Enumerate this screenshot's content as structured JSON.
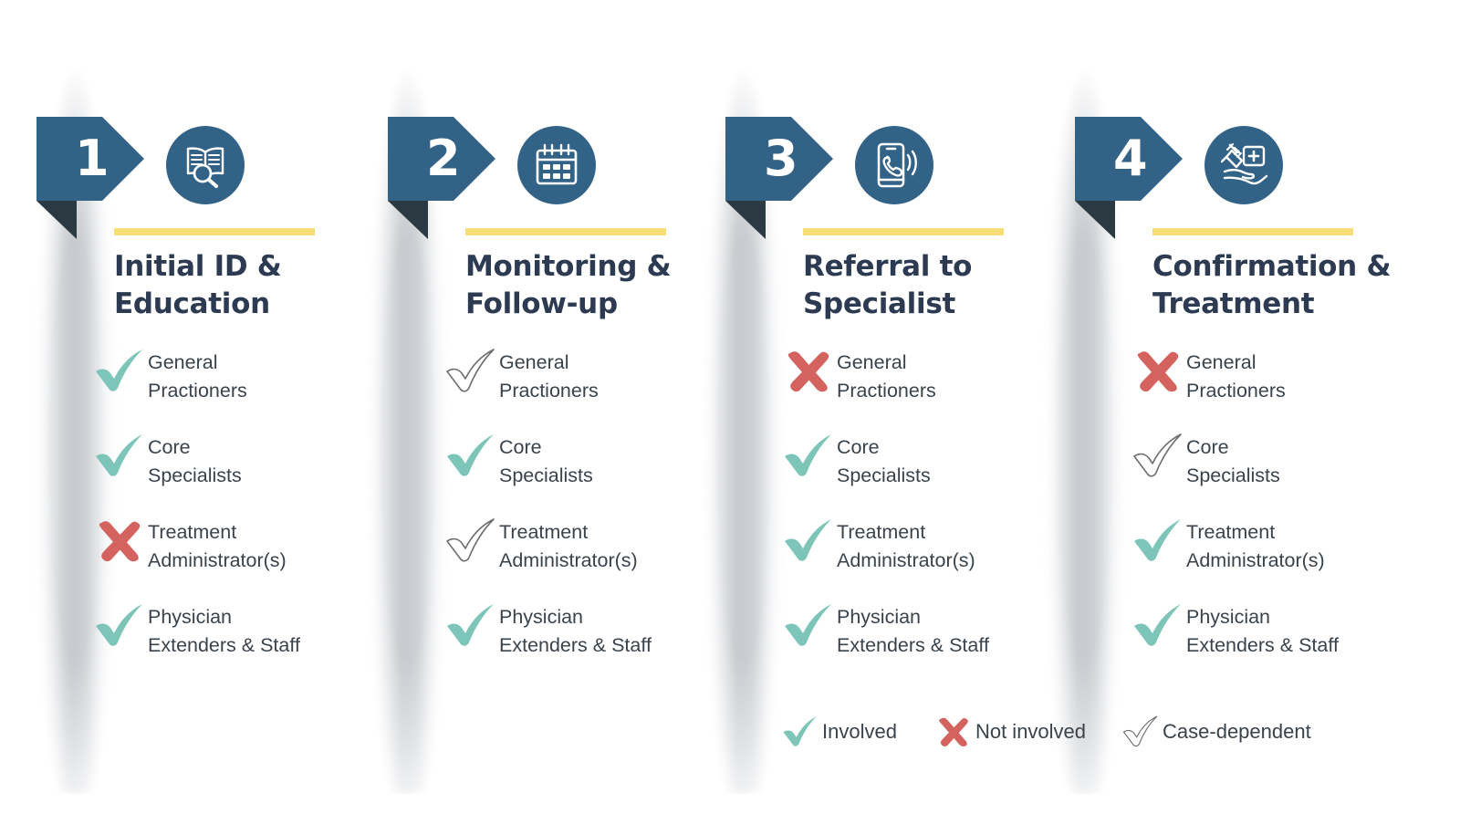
{
  "colors": {
    "brand_blue": "#336287",
    "fold_dark": "#2b3a42",
    "accent_yellow": "#F7DE77",
    "title_navy": "#2d3b52",
    "check_teal": "#7CC5B8",
    "cross_red": "#D4635F",
    "outline_gray": "#6E6E6E",
    "body_text": "#3a434c",
    "background": "#FFFFFF"
  },
  "columns": [
    {
      "number": "1",
      "icon": "book-search-icon",
      "title": "Initial ID &\nEducation",
      "items": [
        {
          "label": "General\nPractioners",
          "mark": "check"
        },
        {
          "label": "Core\nSpecialists",
          "mark": "check"
        },
        {
          "label": "Treatment\nAdministrator(s)",
          "mark": "cross"
        },
        {
          "label": "Physician\nExtenders & Staff",
          "mark": "check"
        }
      ]
    },
    {
      "number": "2",
      "icon": "calendar-icon",
      "title": "Monitoring\n& Follow-up",
      "items": [
        {
          "label": "General\nPractioners",
          "mark": "outline"
        },
        {
          "label": "Core\nSpecialists",
          "mark": "check"
        },
        {
          "label": "Treatment\nAdministrator(s)",
          "mark": "outline"
        },
        {
          "label": "Physician\nExtenders & Staff",
          "mark": "check"
        }
      ]
    },
    {
      "number": "3",
      "icon": "phone-call-icon",
      "title": "Referral to\nSpecialist",
      "items": [
        {
          "label": "General\nPractioners",
          "mark": "cross"
        },
        {
          "label": "Core\nSpecialists",
          "mark": "check"
        },
        {
          "label": "Treatment\nAdministrator(s)",
          "mark": "check"
        },
        {
          "label": "Physician\nExtenders & Staff",
          "mark": "check"
        }
      ]
    },
    {
      "number": "4",
      "icon": "syringe-hand-icon",
      "title": "Confirmation\n& Treatment",
      "items": [
        {
          "label": "General\nPractioners",
          "mark": "cross"
        },
        {
          "label": "Core\nSpecialists",
          "mark": "outline"
        },
        {
          "label": "Treatment\nAdministrator(s)",
          "mark": "check"
        },
        {
          "label": "Physician\nExtenders & Staff",
          "mark": "check"
        }
      ]
    }
  ],
  "legend": [
    {
      "mark": "check",
      "label": "Involved"
    },
    {
      "mark": "cross",
      "label": "Not involved"
    },
    {
      "mark": "outline",
      "label": "Case-dependent"
    }
  ]
}
